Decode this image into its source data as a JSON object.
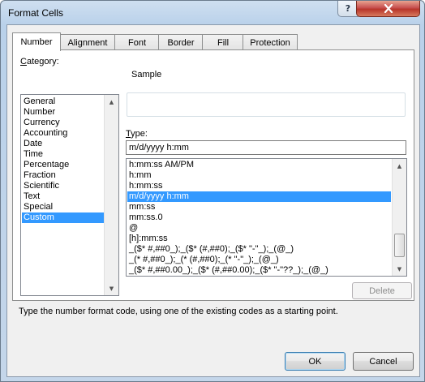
{
  "window": {
    "title": "Format Cells"
  },
  "titlebar": {
    "help_label": "?"
  },
  "tabs": [
    "Number",
    "Alignment",
    "Font",
    "Border",
    "Fill",
    "Protection"
  ],
  "category": {
    "label_prefix": "C",
    "label_rest": "ategory:",
    "items": [
      "General",
      "Number",
      "Currency",
      "Accounting",
      "Date",
      "Time",
      "Percentage",
      "Fraction",
      "Scientific",
      "Text",
      "Special",
      "Custom"
    ],
    "selected": "Custom"
  },
  "sample": {
    "label": "Sample"
  },
  "type": {
    "label_prefix": "T",
    "label_rest": "ype:",
    "value": "m/d/yyyy h:mm"
  },
  "format_codes": {
    "items": [
      "h:mm:ss AM/PM",
      "h:mm",
      "h:mm:ss",
      "m/d/yyyy h:mm",
      "mm:ss",
      "mm:ss.0",
      "@",
      "[h]:mm:ss",
      "_($* #,##0_);_($* (#,##0);_($* \"-\"_);_(@_)",
      "_(* #,##0_);_(* (#,##0);_(* \"-\"_);_(@_)",
      "_($* #,##0.00_);_($* (#,##0.00);_($* \"-\"??_);_(@_)"
    ],
    "selected": "m/d/yyyy h:mm"
  },
  "delete_label": "Delete",
  "hint": "Type the number format code, using one of the existing codes as a starting point.",
  "buttons": {
    "ok": "OK",
    "cancel": "Cancel"
  },
  "colors": {
    "selection": "#3399ff",
    "close": "#c75050"
  }
}
